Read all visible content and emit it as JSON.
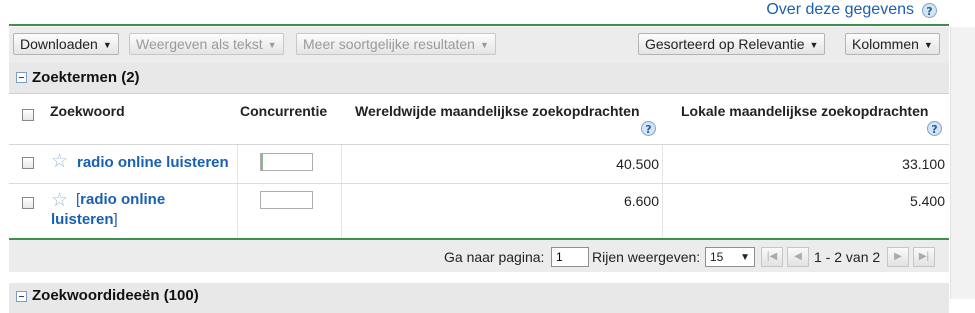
{
  "top": {
    "about_link": "Over deze gegevens"
  },
  "toolbar": {
    "download": "Downloaden",
    "view_as_text": "Weergeven als tekst",
    "more_similar": "Meer soortgelijke resultaten",
    "sorted_by": "Gesorteerd op Relevantie",
    "columns": "Kolommen"
  },
  "search_terms": {
    "title": "Zoektermen (2)",
    "columns": {
      "keyword": "Zoekwoord",
      "competition": "Concurrentie",
      "global_monthly": "Wereldwijde maandelijkse zoekopdrachten",
      "local_monthly": "Lokale maandelijkse zoekopdrachten"
    },
    "rows": [
      {
        "keyword": "radio online luisteren",
        "competition": 0.04,
        "global": "40.500",
        "local": "33.100"
      },
      {
        "keyword_open": "[",
        "keyword_line1": "radio online",
        "keyword_line2": "luisteren",
        "keyword_close": "]",
        "competition": 0.0,
        "global": "6.600",
        "local": "5.400"
      }
    ]
  },
  "pager": {
    "goto_label": "Ga naar pagina:",
    "page_value": "1",
    "rows_label": "Rijen weergeven:",
    "rows_value": "15",
    "range": "1 - 2 van 2"
  },
  "keyword_ideas": {
    "title": "Zoekwoordideeën (100)"
  },
  "colors": {
    "accent_green": "#3d8f4d",
    "link_blue": "#1a5fb4"
  }
}
